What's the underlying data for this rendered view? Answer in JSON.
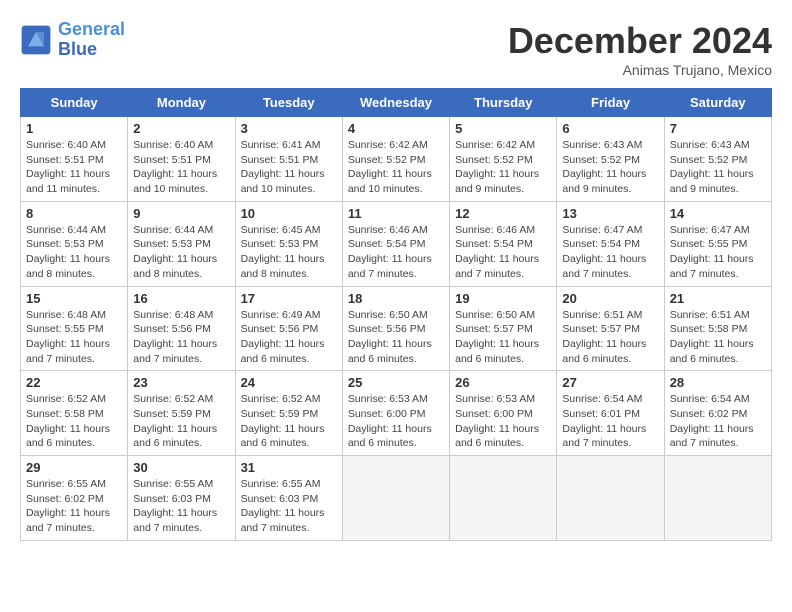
{
  "header": {
    "logo_line1": "General",
    "logo_line2": "Blue",
    "month": "December 2024",
    "location": "Animas Trujano, Mexico"
  },
  "days_of_week": [
    "Sunday",
    "Monday",
    "Tuesday",
    "Wednesday",
    "Thursday",
    "Friday",
    "Saturday"
  ],
  "weeks": [
    [
      {
        "day": "1",
        "sunrise": "Sunrise: 6:40 AM",
        "sunset": "Sunset: 5:51 PM",
        "daylight": "Daylight: 11 hours and 11 minutes."
      },
      {
        "day": "2",
        "sunrise": "Sunrise: 6:40 AM",
        "sunset": "Sunset: 5:51 PM",
        "daylight": "Daylight: 11 hours and 10 minutes."
      },
      {
        "day": "3",
        "sunrise": "Sunrise: 6:41 AM",
        "sunset": "Sunset: 5:51 PM",
        "daylight": "Daylight: 11 hours and 10 minutes."
      },
      {
        "day": "4",
        "sunrise": "Sunrise: 6:42 AM",
        "sunset": "Sunset: 5:52 PM",
        "daylight": "Daylight: 11 hours and 10 minutes."
      },
      {
        "day": "5",
        "sunrise": "Sunrise: 6:42 AM",
        "sunset": "Sunset: 5:52 PM",
        "daylight": "Daylight: 11 hours and 9 minutes."
      },
      {
        "day": "6",
        "sunrise": "Sunrise: 6:43 AM",
        "sunset": "Sunset: 5:52 PM",
        "daylight": "Daylight: 11 hours and 9 minutes."
      },
      {
        "day": "7",
        "sunrise": "Sunrise: 6:43 AM",
        "sunset": "Sunset: 5:52 PM",
        "daylight": "Daylight: 11 hours and 9 minutes."
      }
    ],
    [
      {
        "day": "8",
        "sunrise": "Sunrise: 6:44 AM",
        "sunset": "Sunset: 5:53 PM",
        "daylight": "Daylight: 11 hours and 8 minutes."
      },
      {
        "day": "9",
        "sunrise": "Sunrise: 6:44 AM",
        "sunset": "Sunset: 5:53 PM",
        "daylight": "Daylight: 11 hours and 8 minutes."
      },
      {
        "day": "10",
        "sunrise": "Sunrise: 6:45 AM",
        "sunset": "Sunset: 5:53 PM",
        "daylight": "Daylight: 11 hours and 8 minutes."
      },
      {
        "day": "11",
        "sunrise": "Sunrise: 6:46 AM",
        "sunset": "Sunset: 5:54 PM",
        "daylight": "Daylight: 11 hours and 7 minutes."
      },
      {
        "day": "12",
        "sunrise": "Sunrise: 6:46 AM",
        "sunset": "Sunset: 5:54 PM",
        "daylight": "Daylight: 11 hours and 7 minutes."
      },
      {
        "day": "13",
        "sunrise": "Sunrise: 6:47 AM",
        "sunset": "Sunset: 5:54 PM",
        "daylight": "Daylight: 11 hours and 7 minutes."
      },
      {
        "day": "14",
        "sunrise": "Sunrise: 6:47 AM",
        "sunset": "Sunset: 5:55 PM",
        "daylight": "Daylight: 11 hours and 7 minutes."
      }
    ],
    [
      {
        "day": "15",
        "sunrise": "Sunrise: 6:48 AM",
        "sunset": "Sunset: 5:55 PM",
        "daylight": "Daylight: 11 hours and 7 minutes."
      },
      {
        "day": "16",
        "sunrise": "Sunrise: 6:48 AM",
        "sunset": "Sunset: 5:56 PM",
        "daylight": "Daylight: 11 hours and 7 minutes."
      },
      {
        "day": "17",
        "sunrise": "Sunrise: 6:49 AM",
        "sunset": "Sunset: 5:56 PM",
        "daylight": "Daylight: 11 hours and 6 minutes."
      },
      {
        "day": "18",
        "sunrise": "Sunrise: 6:50 AM",
        "sunset": "Sunset: 5:56 PM",
        "daylight": "Daylight: 11 hours and 6 minutes."
      },
      {
        "day": "19",
        "sunrise": "Sunrise: 6:50 AM",
        "sunset": "Sunset: 5:57 PM",
        "daylight": "Daylight: 11 hours and 6 minutes."
      },
      {
        "day": "20",
        "sunrise": "Sunrise: 6:51 AM",
        "sunset": "Sunset: 5:57 PM",
        "daylight": "Daylight: 11 hours and 6 minutes."
      },
      {
        "day": "21",
        "sunrise": "Sunrise: 6:51 AM",
        "sunset": "Sunset: 5:58 PM",
        "daylight": "Daylight: 11 hours and 6 minutes."
      }
    ],
    [
      {
        "day": "22",
        "sunrise": "Sunrise: 6:52 AM",
        "sunset": "Sunset: 5:58 PM",
        "daylight": "Daylight: 11 hours and 6 minutes."
      },
      {
        "day": "23",
        "sunrise": "Sunrise: 6:52 AM",
        "sunset": "Sunset: 5:59 PM",
        "daylight": "Daylight: 11 hours and 6 minutes."
      },
      {
        "day": "24",
        "sunrise": "Sunrise: 6:52 AM",
        "sunset": "Sunset: 5:59 PM",
        "daylight": "Daylight: 11 hours and 6 minutes."
      },
      {
        "day": "25",
        "sunrise": "Sunrise: 6:53 AM",
        "sunset": "Sunset: 6:00 PM",
        "daylight": "Daylight: 11 hours and 6 minutes."
      },
      {
        "day": "26",
        "sunrise": "Sunrise: 6:53 AM",
        "sunset": "Sunset: 6:00 PM",
        "daylight": "Daylight: 11 hours and 6 minutes."
      },
      {
        "day": "27",
        "sunrise": "Sunrise: 6:54 AM",
        "sunset": "Sunset: 6:01 PM",
        "daylight": "Daylight: 11 hours and 7 minutes."
      },
      {
        "day": "28",
        "sunrise": "Sunrise: 6:54 AM",
        "sunset": "Sunset: 6:02 PM",
        "daylight": "Daylight: 11 hours and 7 minutes."
      }
    ],
    [
      {
        "day": "29",
        "sunrise": "Sunrise: 6:55 AM",
        "sunset": "Sunset: 6:02 PM",
        "daylight": "Daylight: 11 hours and 7 minutes."
      },
      {
        "day": "30",
        "sunrise": "Sunrise: 6:55 AM",
        "sunset": "Sunset: 6:03 PM",
        "daylight": "Daylight: 11 hours and 7 minutes."
      },
      {
        "day": "31",
        "sunrise": "Sunrise: 6:55 AM",
        "sunset": "Sunset: 6:03 PM",
        "daylight": "Daylight: 11 hours and 7 minutes."
      },
      null,
      null,
      null,
      null
    ]
  ]
}
